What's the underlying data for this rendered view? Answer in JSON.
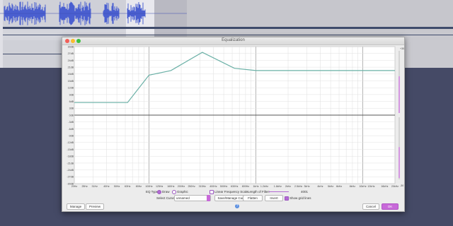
{
  "dialog": {
    "title": "Equalization"
  },
  "eq_curve": {
    "freq_ticks": [
      "20Hz",
      "25Hz",
      "31Hz",
      "40Hz",
      "50Hz",
      "63Hz",
      "80Hz",
      "100Hz",
      "125Hz",
      "160Hz",
      "200Hz",
      "250Hz",
      "315Hz",
      "400Hz",
      "500Hz",
      "630Hz",
      "800Hz",
      "1kHz",
      "1.2kHz",
      "1.6kHz",
      "2kHz",
      "2.5kHz",
      "3kHz",
      "4kHz",
      "5kHz",
      "6kHz",
      "8kHz",
      "10kHz",
      "12kHz",
      "16kHz",
      "20kHz"
    ],
    "db_ticks": [
      "30dB",
      "27dB",
      "24dB",
      "21dB",
      "18dB",
      "15dB",
      "12dB",
      "9dB",
      "6dB",
      "3dB",
      "0dB",
      "-3dB",
      "-6dB",
      "-9dB",
      "-12dB",
      "-15dB",
      "-18dB",
      "-21dB",
      "-24dB",
      "-27dB",
      "-30dB"
    ],
    "points": [
      [
        20,
        5.5
      ],
      [
        63,
        5.5
      ],
      [
        100,
        17.5
      ],
      [
        160,
        19.5
      ],
      [
        315,
        27.5
      ],
      [
        630,
        20.5
      ],
      [
        1000,
        19.5
      ],
      [
        20000,
        19.5
      ]
    ],
    "db_range": [
      -30,
      30
    ],
    "freq_range": [
      20,
      20000
    ],
    "curve_color": "#6ab0a6",
    "slider_range_labels": [
      "+30",
      "-30"
    ]
  },
  "controls": {
    "eq_type_label": "EQ Type:",
    "eq_type_draw": "Draw",
    "eq_type_graphic": "Graphic",
    "linear_freq_scale": "Linear Frequency Scale",
    "length_of_filter": "Length of Filter:",
    "filter_length_value": "4001",
    "select_curve_label": "Select Curve:",
    "select_curve_value": "unnamed",
    "save_manage_curves": "Save/Manage Curves...",
    "flatten": "Flatten",
    "invert": "Invert",
    "show_grid_lines": "Show grid lines"
  },
  "footer": {
    "manage": "Manage",
    "preview": "Preview",
    "help": "?",
    "cancel": "Cancel",
    "ok": "OK"
  },
  "colors": {
    "accent": "#c869d9",
    "background": "#454a66"
  }
}
